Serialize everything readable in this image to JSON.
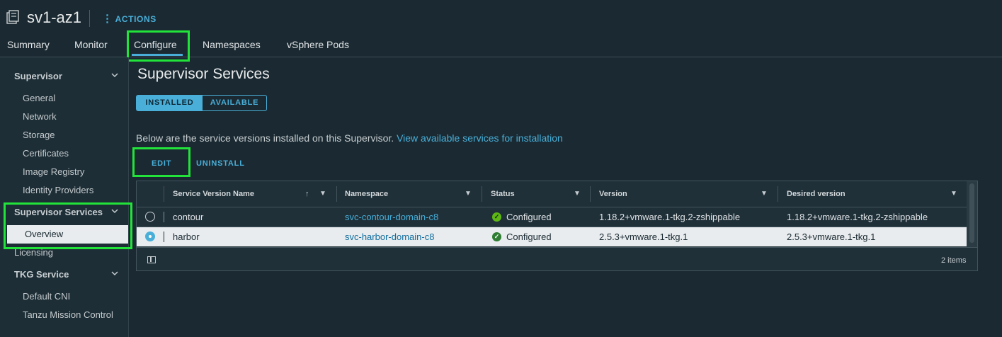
{
  "header": {
    "title": "sv1-az1",
    "actions_label": "ACTIONS"
  },
  "tabs": [
    {
      "label": "Summary"
    },
    {
      "label": "Monitor"
    },
    {
      "label": "Configure",
      "active": true
    },
    {
      "label": "Namespaces"
    },
    {
      "label": "vSphere Pods"
    }
  ],
  "sidebar": {
    "groups": [
      {
        "label": "Supervisor",
        "items": [
          "General",
          "Network",
          "Storage",
          "Certificates",
          "Image Registry",
          "Identity Providers"
        ]
      },
      {
        "label": "Supervisor Services",
        "items": [
          "Overview"
        ],
        "active_item": "Overview"
      },
      {
        "label": "Licensing"
      },
      {
        "label": "TKG Service",
        "items": [
          "Default CNI",
          "Tanzu Mission Control"
        ]
      }
    ]
  },
  "main": {
    "heading": "Supervisor Services",
    "segment": {
      "installed": "INSTALLED",
      "available": "AVAILABLE",
      "selected": "INSTALLED"
    },
    "description": "Below are the service versions installed on this Supervisor.",
    "description_link": "View available services for installation",
    "edit_label": "EDIT",
    "uninstall_label": "UNINSTALL"
  },
  "grid": {
    "columns": [
      "Service Version Name",
      "Namespace",
      "Status",
      "Version",
      "Desired version"
    ],
    "rows": [
      {
        "name": "contour",
        "namespace": "svc-contour-domain-c8",
        "status": "Configured",
        "version": "1.18.2+vmware.1-tkg.2-zshippable",
        "desired": "1.18.2+vmware.1-tkg.2-zshippable",
        "selected": false
      },
      {
        "name": "harbor",
        "namespace": "svc-harbor-domain-c8",
        "status": "Configured",
        "version": "2.5.3+vmware.1-tkg.1",
        "desired": "2.5.3+vmware.1-tkg.1",
        "selected": true
      }
    ],
    "footer_count": "2 items"
  },
  "colors": {
    "background": "#1b2a32",
    "accent": "#49afd9",
    "highlight": "#22e33a",
    "status_ok": "#5eb715"
  }
}
